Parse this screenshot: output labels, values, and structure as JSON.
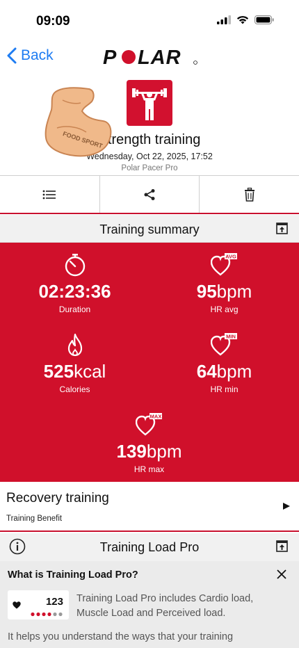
{
  "status_bar": {
    "time": "09:09"
  },
  "nav": {
    "back_label": "Back",
    "brand": "POLAR"
  },
  "header": {
    "sport_name": "Strength training",
    "date": "Wednesday, Oct 22, 2025, 17:52",
    "device": "Polar Pacer Pro",
    "sticker_text": "FOOD SPORT"
  },
  "actions": [
    {
      "icon": "list-icon"
    },
    {
      "icon": "share-icon"
    },
    {
      "icon": "trash-icon"
    }
  ],
  "summary": {
    "title": "Training summary",
    "stats": [
      {
        "value": "02:23:36",
        "unit": "",
        "label": "Duration",
        "icon": "stopwatch-icon"
      },
      {
        "value": "95",
        "unit": "bpm",
        "label": "HR avg",
        "icon": "heart-avg-icon",
        "badge": "AVG"
      },
      {
        "value": "525",
        "unit": "kcal",
        "label": "Calories",
        "icon": "flame-icon"
      },
      {
        "value": "64",
        "unit": "bpm",
        "label": "HR min",
        "icon": "heart-min-icon",
        "badge": "MIN"
      },
      {
        "value": "139",
        "unit": "bpm",
        "label": "HR max",
        "icon": "heart-max-icon",
        "badge": "MAX"
      }
    ]
  },
  "recovery": {
    "title": "Recovery training",
    "subtitle": "Training Benefit"
  },
  "training_load": {
    "title": "Training Load Pro",
    "question": "What is Training Load Pro?",
    "card_number": "123",
    "description": "Training Load Pro includes Cardio load, Muscle Load and Perceived load.",
    "more": "It helps you understand the ways that your training"
  },
  "colors": {
    "accent": "#d0102b",
    "link": "#1e7cf2"
  }
}
